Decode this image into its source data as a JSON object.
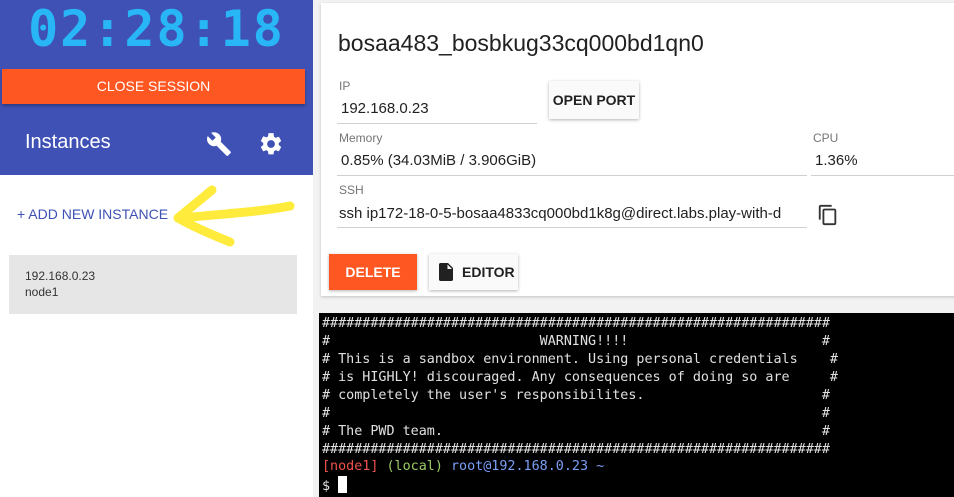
{
  "sidebar": {
    "clock": "02:28:18",
    "close_session_label": "CLOSE SESSION",
    "instances_title": "Instances",
    "add_instance_label": "+ ADD NEW INSTANCE",
    "instances": [
      {
        "ip": "192.168.0.23",
        "name": "node1"
      }
    ]
  },
  "instance": {
    "title": "bosaa483_bosbkug33cq000bd1qn0",
    "ip_label": "IP",
    "ip_value": "192.168.0.23",
    "open_port_label": "OPEN PORT",
    "memory_label": "Memory",
    "memory_value": "0.85% (34.03MiB / 3.906GiB)",
    "cpu_label": "CPU",
    "cpu_value": "1.36%",
    "ssh_label": "SSH",
    "ssh_value": "ssh ip172-18-0-5-bosaa4833cq000bd1k8g@direct.labs.play-with-d",
    "delete_label": "DELETE",
    "editor_label": "EDITOR"
  },
  "terminal": {
    "lines": [
      "###############################################################",
      "#                          WARNING!!!!                        #",
      "# This is a sandbox environment. Using personal credentials    #",
      "# is HIGHLY! discouraged. Any consequences of doing so are     #",
      "# completely the user's responsibilites.                      #",
      "#                                                             #",
      "# The PWD team.                                               #",
      "###############################################################"
    ],
    "prompt_host": "[node1]",
    "prompt_ctx": "(local)",
    "prompt_user": "root@192.168.0.23 ~",
    "prompt_symbol": "$"
  },
  "colors": {
    "sidebar_header": "#3f51b5",
    "clock": "#29b6f6",
    "accent": "#ff5722",
    "annotation": "#ffeb3b"
  },
  "icons": [
    "wrench-icon",
    "gear-icon",
    "copy-icon",
    "file-icon"
  ]
}
